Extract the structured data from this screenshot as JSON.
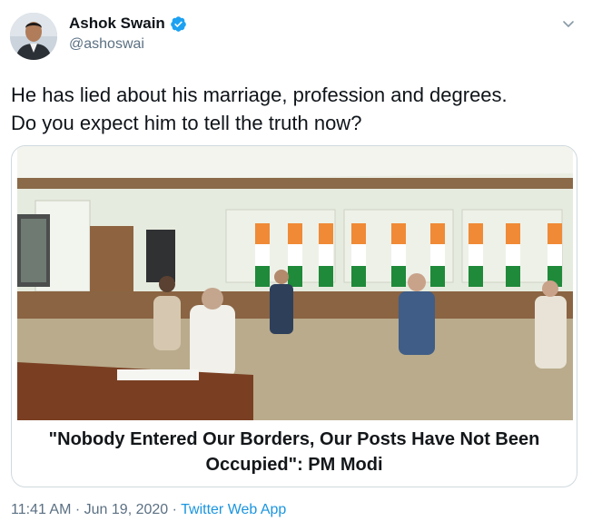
{
  "author": {
    "display_name": "Ashok Swain",
    "handle": "@ashoswai",
    "verified": true
  },
  "tweet": {
    "text_line1": "He has lied about his marriage, profession and degrees.",
    "text_line2": "Do you expect him to tell the truth now?"
  },
  "card": {
    "title_line1": "\"Nobody Entered Our Borders, Our Posts Have Not Been",
    "title_line2": "Occupied\": PM Modi"
  },
  "meta": {
    "time": "11:41 AM",
    "separator": "·",
    "date": "Jun 19, 2020",
    "source": "Twitter Web App"
  },
  "colors": {
    "verified_badge": "#1da1f2",
    "link": "#1b95e0",
    "secondary_text": "#5b7083"
  },
  "icons": {
    "verified": "verified-badge-icon",
    "more": "chevron-down-icon"
  }
}
